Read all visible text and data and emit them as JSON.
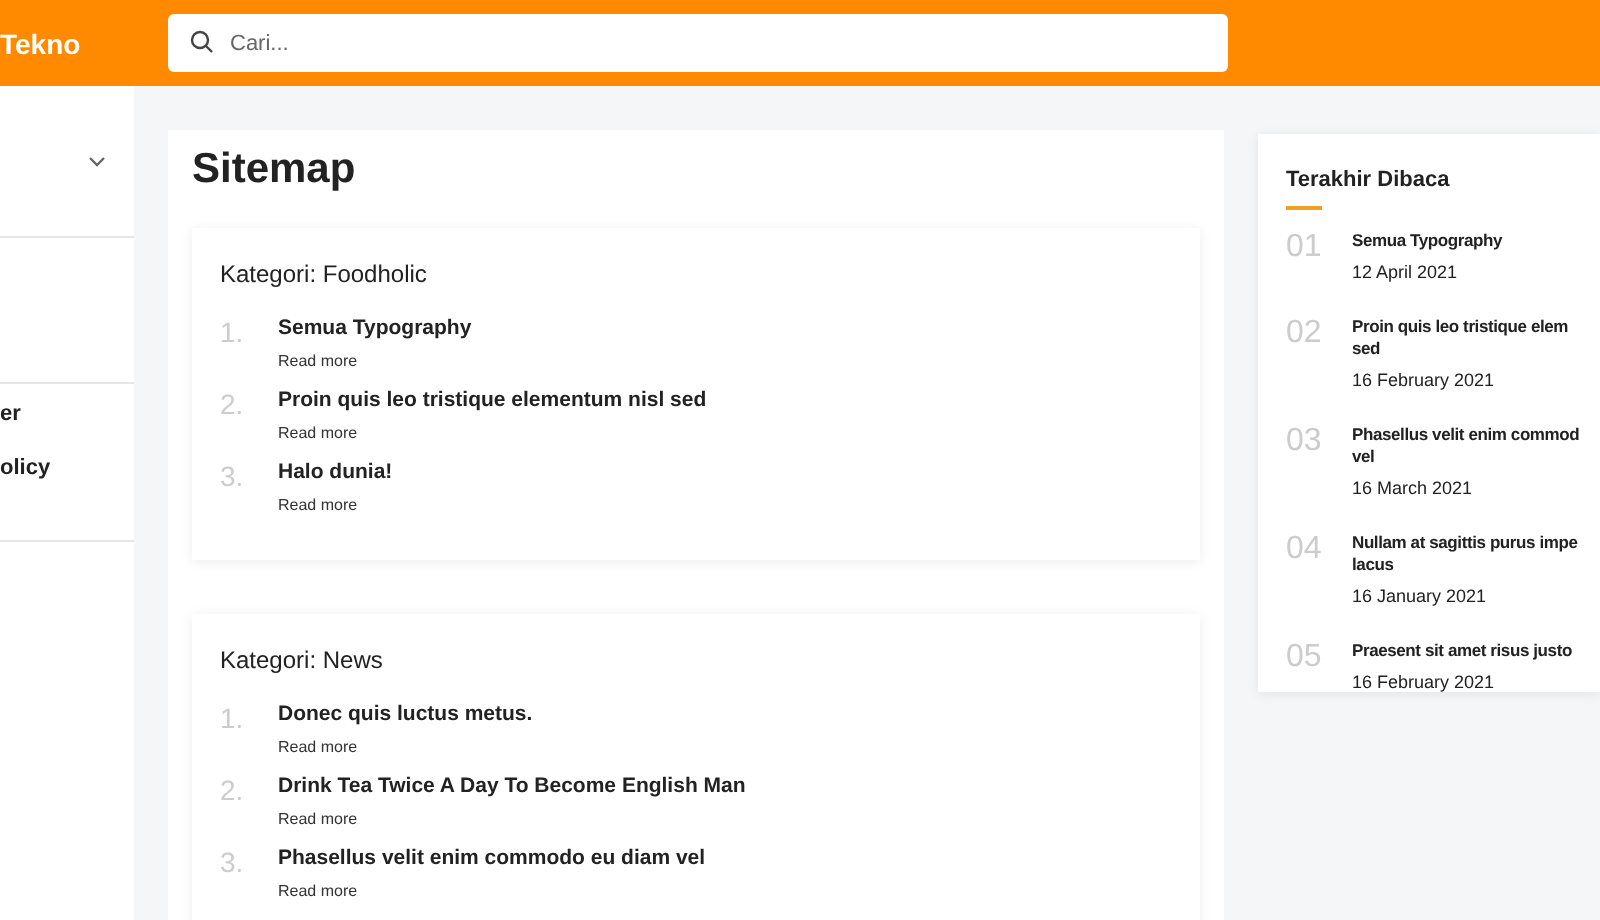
{
  "header": {
    "logo": "Tekno",
    "search": {
      "placeholder": "Cari..."
    }
  },
  "sidebar": {
    "items": [
      {
        "kind": "dropdown"
      },
      {
        "kind": "spacer"
      },
      {
        "kind": "link",
        "label": "er"
      },
      {
        "kind": "link",
        "label": "olicy"
      }
    ]
  },
  "page": {
    "title": "Sitemap",
    "categories": [
      {
        "title": "Kategori: Foodholic",
        "posts": [
          {
            "number": "1.",
            "title": "Semua Typography",
            "link": "Read more"
          },
          {
            "number": "2.",
            "title": "Proin quis leo tristique elementum nisl sed",
            "link": "Read more"
          },
          {
            "number": "3.",
            "title": "Halo dunia!",
            "link": "Read more"
          }
        ]
      },
      {
        "title": "Kategori: News",
        "posts": [
          {
            "number": "1.",
            "title": "Donec quis luctus metus.",
            "link": "Read more"
          },
          {
            "number": "2.",
            "title": "Drink Tea Twice A Day To Become English Man",
            "link": "Read more"
          },
          {
            "number": "3.",
            "title": "Phasellus velit enim commodo eu diam vel",
            "link": "Read more"
          }
        ]
      }
    ]
  },
  "recent": {
    "title": "Terakhir Dibaca",
    "items": [
      {
        "number": "01",
        "title_lines": [
          "Semua Typography"
        ],
        "date": "12 April 2021"
      },
      {
        "number": "02",
        "title_lines": [
          "Proin quis leo tristique elem",
          "sed"
        ],
        "date": "16 February 2021"
      },
      {
        "number": "03",
        "title_lines": [
          "Phasellus velit enim commod",
          "vel"
        ],
        "date": "16 March 2021"
      },
      {
        "number": "04",
        "title_lines": [
          "Nullam at sagittis purus impe",
          "lacus"
        ],
        "date": "16 January 2021"
      },
      {
        "number": "05",
        "title_lines": [
          "Praesent sit amet risus justo"
        ],
        "date": "16 February 2021"
      }
    ]
  }
}
